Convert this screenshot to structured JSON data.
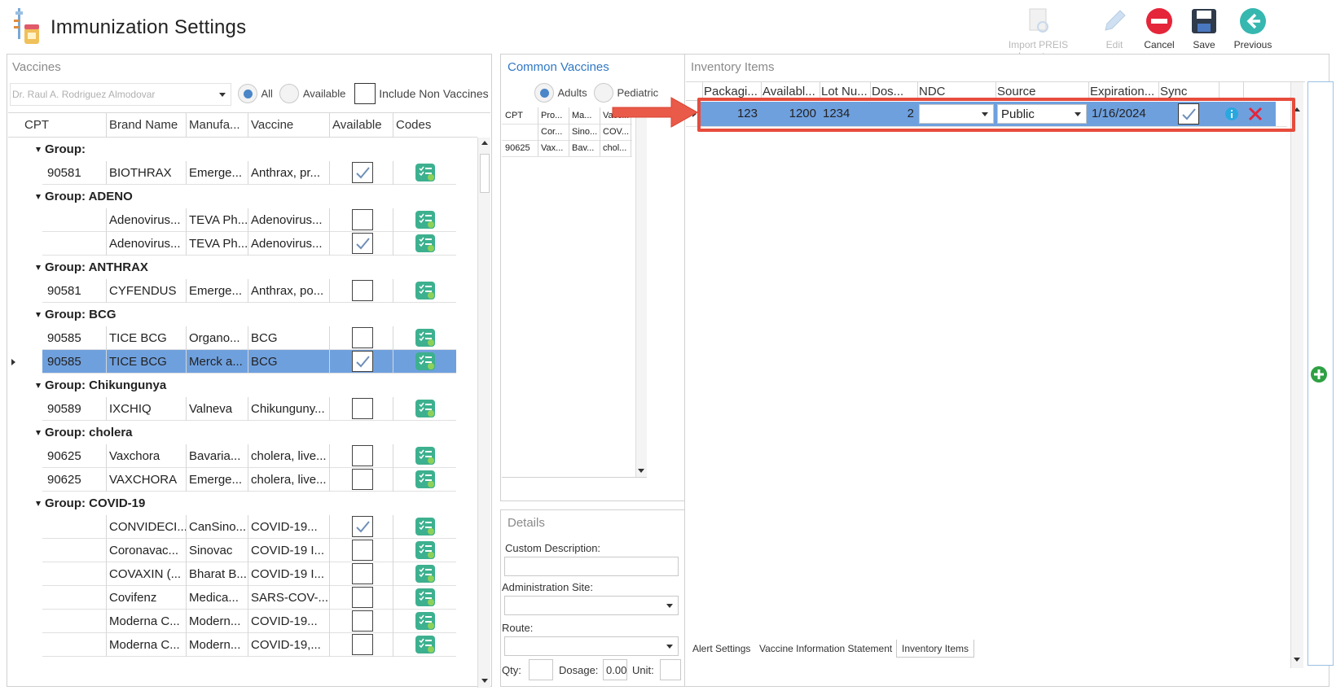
{
  "header": {
    "title": "Immunization Settings"
  },
  "toolbar": [
    {
      "label": "Import PREIS Inventory",
      "icon": "import-document-icon",
      "enabled": false
    },
    {
      "label": "Edit",
      "icon": "pencil-icon",
      "enabled": false
    },
    {
      "label": "Cancel",
      "icon": "cancel-icon",
      "enabled": true
    },
    {
      "label": "Save",
      "icon": "save-icon",
      "enabled": true
    },
    {
      "label": "Previous",
      "icon": "arrow-left-icon",
      "enabled": true
    }
  ],
  "vaccines": {
    "title": "Vaccines",
    "provider": "Dr. Raul A. Rodriguez Almodovar",
    "filter_all": "All",
    "filter_available": "Available",
    "include_non": "Include Non Vaccines",
    "columns": [
      "CPT",
      "Brand Name",
      "Manufa...",
      "Vaccine",
      "Available",
      "Codes"
    ],
    "rows": [
      {
        "type": "group",
        "label": "Group:"
      },
      {
        "type": "row",
        "cpt": "90581",
        "brand": "BIOTHRAX",
        "manu": "Emerge...",
        "vaccine": "Anthrax, pr...",
        "available": true
      },
      {
        "type": "group",
        "label": "Group: ADENO"
      },
      {
        "type": "row",
        "cpt": "",
        "brand": "Adenovirus...",
        "manu": "TEVA Ph...",
        "vaccine": "Adenovirus...",
        "available": false
      },
      {
        "type": "row",
        "cpt": "",
        "brand": "Adenovirus...",
        "manu": "TEVA Ph...",
        "vaccine": "Adenovirus...",
        "available": true
      },
      {
        "type": "group",
        "label": "Group: ANTHRAX"
      },
      {
        "type": "row",
        "cpt": "90581",
        "brand": "CYFENDUS",
        "manu": "Emerge...",
        "vaccine": "Anthrax, po...",
        "available": false
      },
      {
        "type": "group",
        "label": "Group: BCG"
      },
      {
        "type": "row",
        "cpt": "90585",
        "brand": "TICE BCG",
        "manu": "Organo...",
        "vaccine": "BCG",
        "available": false
      },
      {
        "type": "row",
        "cpt": "90585",
        "brand": "TICE BCG",
        "manu": "Merck a...",
        "vaccine": "BCG",
        "available": true,
        "selected": true
      },
      {
        "type": "group",
        "label": "Group: Chikungunya"
      },
      {
        "type": "row",
        "cpt": "90589",
        "brand": "IXCHIQ",
        "manu": "Valneva",
        "vaccine": "Chikunguny...",
        "available": false
      },
      {
        "type": "group",
        "label": "Group: cholera"
      },
      {
        "type": "row",
        "cpt": "90625",
        "brand": "Vaxchora",
        "manu": "Bavaria...",
        "vaccine": "cholera, live...",
        "available": false
      },
      {
        "type": "row",
        "cpt": "90625",
        "brand": "VAXCHORA",
        "manu": "Emerge...",
        "vaccine": "cholera, live...",
        "available": false
      },
      {
        "type": "group",
        "label": "Group: COVID-19"
      },
      {
        "type": "row",
        "cpt": "",
        "brand": "CONVIDECI...",
        "manu": "CanSino...",
        "vaccine": "COVID-19...",
        "available": true
      },
      {
        "type": "row",
        "cpt": "",
        "brand": "Coronavac...",
        "manu": "Sinovac",
        "vaccine": "COVID-19 I...",
        "available": false
      },
      {
        "type": "row",
        "cpt": "",
        "brand": "COVAXIN (...",
        "manu": "Bharat B...",
        "vaccine": "COVID-19 I...",
        "available": false
      },
      {
        "type": "row",
        "cpt": "",
        "brand": "Covifenz",
        "manu": "Medica...",
        "vaccine": "SARS-COV-...",
        "available": false
      },
      {
        "type": "row",
        "cpt": "",
        "brand": "Moderna C...",
        "manu": "Modern...",
        "vaccine": "COVID-19...",
        "available": false
      },
      {
        "type": "row",
        "cpt": "",
        "brand": "Moderna C...",
        "manu": "Modern...",
        "vaccine": "COVID-19,...",
        "available": false
      }
    ]
  },
  "common": {
    "title": "Common Vaccines",
    "adults": "Adults",
    "pediatric": "Pediatric",
    "columns": [
      "CPT",
      "Pro...",
      "Ma...",
      "Vacci..."
    ],
    "rows": [
      [
        "",
        "Cor...",
        "Sino...",
        "COV..."
      ],
      [
        "90625",
        "Vax...",
        "Bav...",
        "chol..."
      ]
    ]
  },
  "details": {
    "title": "Details",
    "custom_desc": "Custom Description:",
    "admin_site": "Administration Site:",
    "route": "Route:",
    "qty": "Qty:",
    "dosage": "Dosage:",
    "dosage_value": "0.00",
    "unit": "Unit:"
  },
  "inventory": {
    "title": "Inventory Items",
    "columns": [
      "Packagi...",
      "Availabl...",
      "Lot Nu...",
      "Dos...",
      "NDC",
      "Source",
      "Expiration...",
      "Sync"
    ],
    "rows": [
      {
        "packaging": "123",
        "available": "1200",
        "lot": "1234",
        "doses": "2",
        "ndc": "",
        "source": "Public",
        "expiration": "1/16/2024",
        "sync": true
      }
    ]
  },
  "tabs": [
    "Alert Settings",
    "Vaccine Information Statement",
    "Inventory Items"
  ],
  "colors": {
    "selection": "#6fa0de",
    "accent": "#2f78c4",
    "highlight": "#e74c3c",
    "codes": "#3db08f"
  }
}
